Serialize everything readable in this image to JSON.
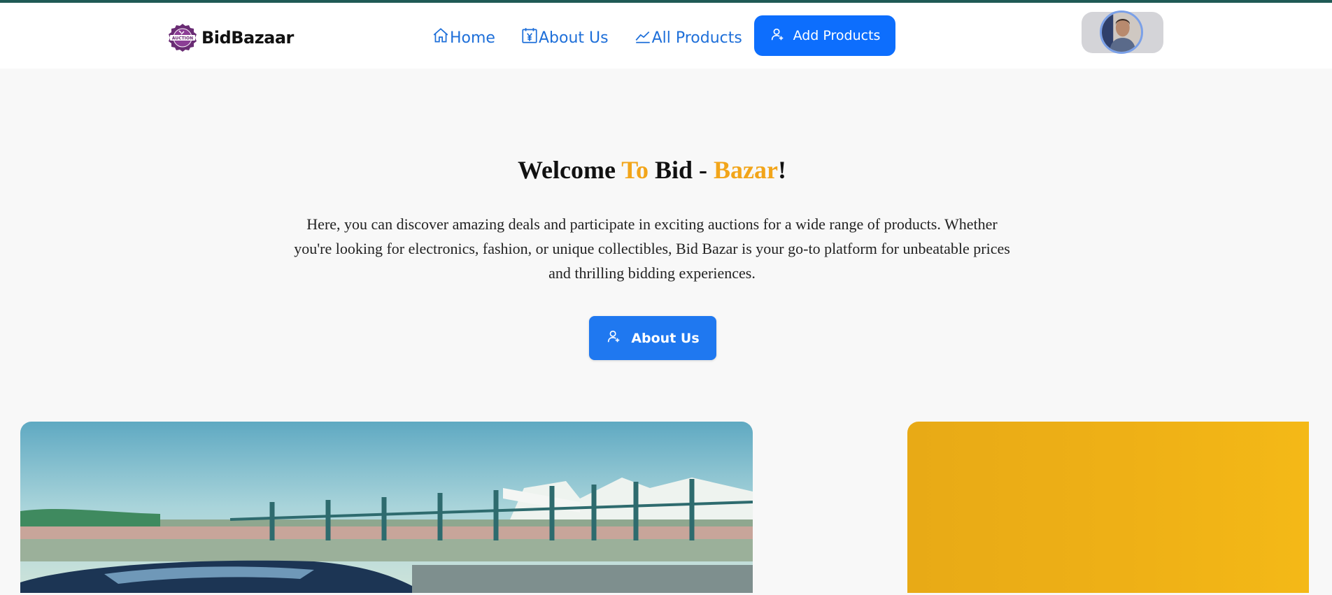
{
  "brand": {
    "name": "BidBazaar",
    "logo_icon": "auction-seal-icon",
    "logo_text": "AUCTION"
  },
  "nav": {
    "links": [
      {
        "label": "Home",
        "icon": "home-icon"
      },
      {
        "label": "About Us",
        "icon": "calendar-yen-icon"
      },
      {
        "label": "All Products",
        "icon": "trend-chart-icon"
      }
    ],
    "add_button": {
      "label": "Add Products",
      "icon": "user-plus-icon"
    },
    "avatar": "user-avatar"
  },
  "hero": {
    "title_parts": [
      "Welcome ",
      "To",
      " Bid - ",
      "Bazar",
      "!"
    ],
    "description": "Here, you can discover amazing deals and participate in exciting auctions for a wide range of products. Whether you're looking for electronics, fashion, or unique collectibles, Bid Bazar is your go-to platform for unbeatable prices and thrilling bidding experiences.",
    "button": {
      "label": "About Us",
      "icon": "user-plus-icon"
    }
  },
  "colors": {
    "accent": "#f2a51a",
    "primary": "#0d6efd",
    "link": "#1e6fd9",
    "top_border": "#1f5a55",
    "yellow_card": "#efb116"
  }
}
